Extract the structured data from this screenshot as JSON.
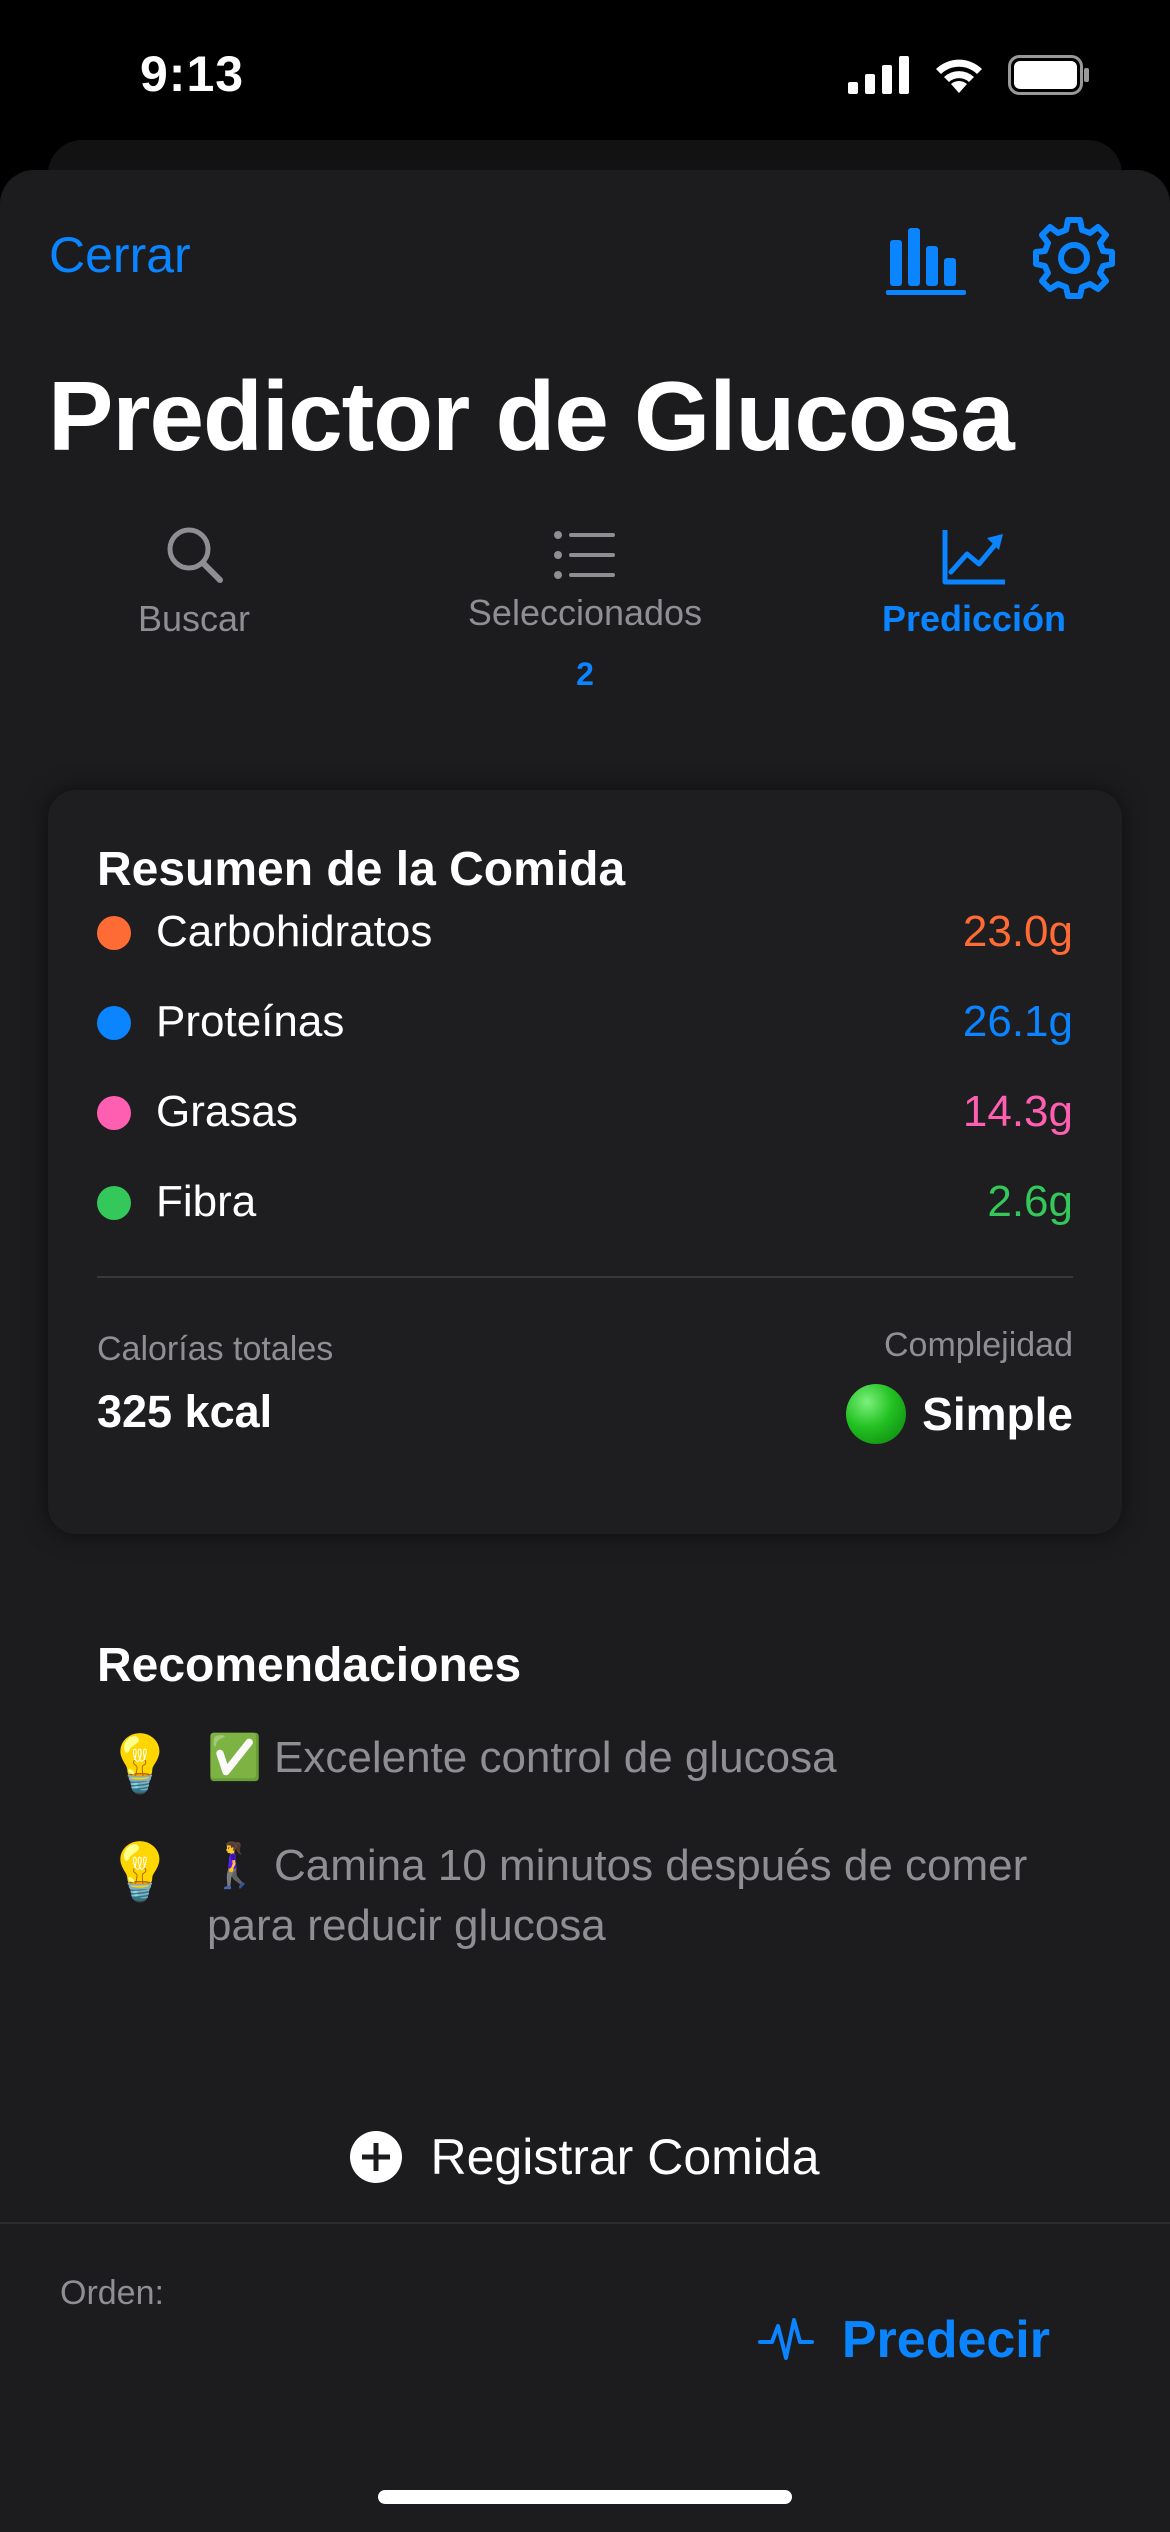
{
  "status_bar": {
    "time": "9:13"
  },
  "header": {
    "close_label": "Cerrar",
    "title": "Predictor de Glucosa",
    "chart_icon": "bar-chart-icon",
    "settings_icon": "gear-icon"
  },
  "tabs": [
    {
      "label": "Buscar",
      "icon": "magnifying-glass-icon",
      "active": false
    },
    {
      "label": "Seleccionados",
      "icon": "list-icon",
      "badge": "2",
      "active": false
    },
    {
      "label": "Predicción",
      "icon": "trend-chart-icon",
      "active": true
    }
  ],
  "summary": {
    "title": "Resumen de la Comida",
    "macros": [
      {
        "name": "Carbohidratos",
        "value": "23.0g",
        "color": "#ff6b35"
      },
      {
        "name": "Proteínas",
        "value": "26.1g",
        "color": "#0a84ff"
      },
      {
        "name": "Grasas",
        "value": "14.3g",
        "color": "#ff5fb0"
      },
      {
        "name": "Fibra",
        "value": "2.6g",
        "color": "#34c759"
      }
    ],
    "calories_label": "Calorías totales",
    "calories_value": "325 kcal",
    "complexity_label": "Complejidad",
    "complexity_value": "Simple"
  },
  "recommendations": {
    "title": "Recomendaciones",
    "items": [
      "✅ Excelente control de glucosa",
      "🚶‍♀️ Camina 10 minutos después de comer para reducir glucosa"
    ]
  },
  "actions": {
    "register_label": "Registrar Comida",
    "order_label": "Orden:",
    "predict_label": "Predecir"
  },
  "colors": {
    "accent": "#0a84ff",
    "background": "#1c1c1e"
  }
}
